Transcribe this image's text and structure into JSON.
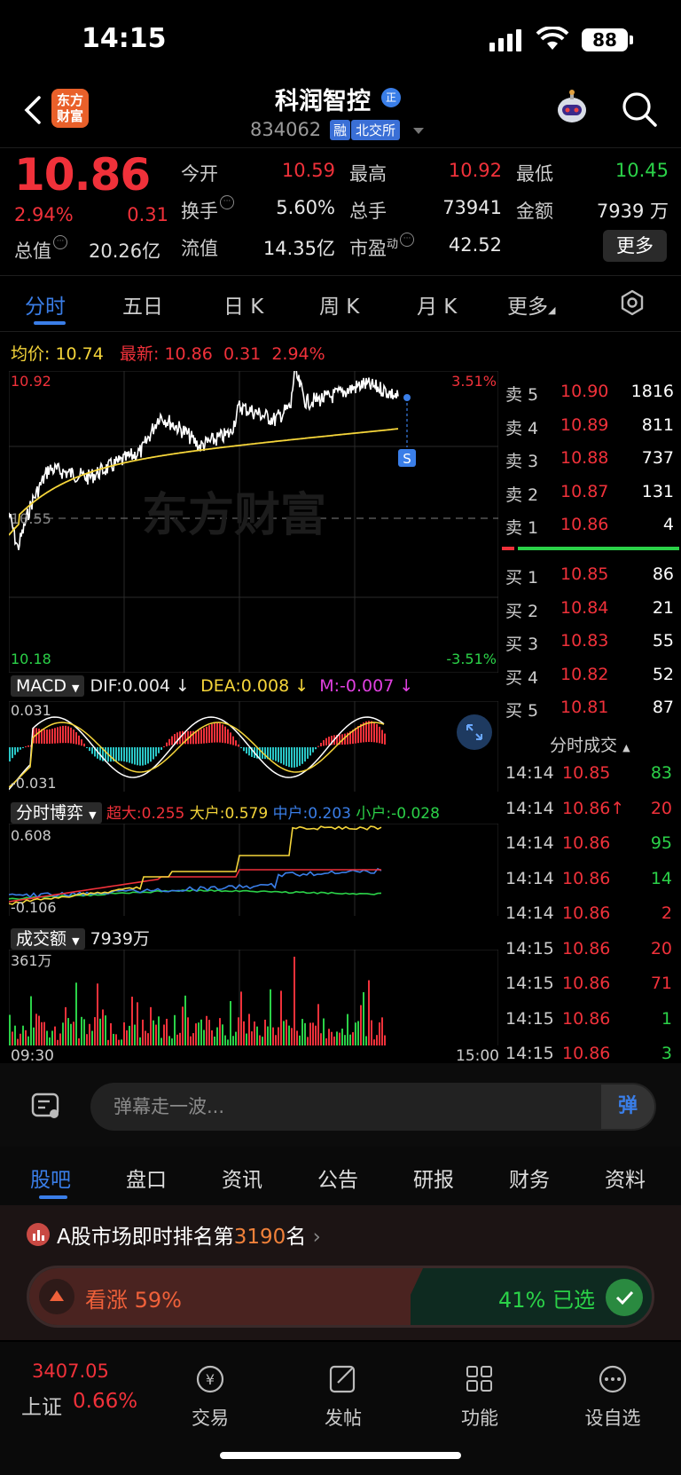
{
  "status": {
    "time": "14:15",
    "battery": "88"
  },
  "header": {
    "logo": "东方财富",
    "stock_name": "科润智控",
    "badge": "正",
    "code": "834062",
    "tag_margin": "融",
    "tag_exchange": "北交所"
  },
  "quote": {
    "price": "10.86",
    "change_pct": "2.94%",
    "change_amt": "0.31",
    "mktcap_label": "总值",
    "mktcap_value": "20.26亿",
    "open_label": "今开",
    "open_value": "10.59",
    "high_label": "最高",
    "high_value": "10.92",
    "low_label": "最低",
    "low_value": "10.45",
    "turnover_label": "换手",
    "turnover_value": "5.60%",
    "vol_label": "总手",
    "vol_value": "73941",
    "amount_label": "金额",
    "amount_value": "7939 万",
    "float_label": "流值",
    "float_value": "14.35亿",
    "pe_label": "市盈",
    "pe_sup": "动",
    "pe_value": "42.52",
    "more": "更多"
  },
  "tabs": [
    "分时",
    "五日",
    "日 K",
    "周 K",
    "月 K",
    "更多"
  ],
  "summary": {
    "avg_label": "均价:",
    "avg_value": "10.74",
    "latest_label": "最新:",
    "latest_value": "10.86",
    "latest_chg": "0.31",
    "latest_pct": "2.94%"
  },
  "main_chart": {
    "ymax_label": "10.92",
    "ymin_label": "10.18",
    "mid_label": "10.55",
    "pct_top": "3.51%",
    "pct_bottom": "-3.51%",
    "watermark": "东方财富",
    "s_marker": "S",
    "time_start": "09:30",
    "time_end": "15:00"
  },
  "macd": {
    "selector": "MACD",
    "dif": "DIF:0.004 ↓",
    "dea": "DEA:0.008 ↓",
    "m": "M:-0.007 ↓",
    "top_label": "0.031",
    "bottom_label": "-0.031"
  },
  "game": {
    "selector": "分时博弈",
    "super": "超大:0.255",
    "large": "大户:0.579",
    "mid": "中户:0.203",
    "small": "小户:-0.028",
    "top_label": "0.608",
    "bottom_label": "-0.106"
  },
  "volume": {
    "selector": "成交额",
    "total": "7939万",
    "top_label": "361万"
  },
  "order_book": {
    "asks": [
      {
        "label": "卖 5",
        "price": "10.90",
        "vol": "1816"
      },
      {
        "label": "卖 4",
        "price": "10.89",
        "vol": "811"
      },
      {
        "label": "卖 3",
        "price": "10.88",
        "vol": "737"
      },
      {
        "label": "卖 2",
        "price": "10.87",
        "vol": "131"
      },
      {
        "label": "卖 1",
        "price": "10.86",
        "vol": "4"
      }
    ],
    "bids": [
      {
        "label": "买 1",
        "price": "10.85",
        "vol": "86"
      },
      {
        "label": "买 2",
        "price": "10.84",
        "vol": "21"
      },
      {
        "label": "买 3",
        "price": "10.83",
        "vol": "55"
      },
      {
        "label": "买 4",
        "price": "10.82",
        "vol": "52"
      },
      {
        "label": "买 5",
        "price": "10.81",
        "vol": "87"
      }
    ]
  },
  "ticks_title": "分时成交",
  "ticks": [
    {
      "time": "14:14",
      "price": "10.85",
      "vol": "83",
      "dir": "green"
    },
    {
      "time": "14:14",
      "price": "10.86↑",
      "vol": "20",
      "dir": "red"
    },
    {
      "time": "14:14",
      "price": "10.86",
      "vol": "95",
      "dir": "green"
    },
    {
      "time": "14:14",
      "price": "10.86",
      "vol": "14",
      "dir": "green"
    },
    {
      "time": "14:14",
      "price": "10.86",
      "vol": "2",
      "dir": "red"
    },
    {
      "time": "14:15",
      "price": "10.86",
      "vol": "20",
      "dir": "red"
    },
    {
      "time": "14:15",
      "price": "10.86",
      "vol": "71",
      "dir": "red"
    },
    {
      "time": "14:15",
      "price": "10.86",
      "vol": "1",
      "dir": "green"
    },
    {
      "time": "14:15",
      "price": "10.86",
      "vol": "3",
      "dir": "green"
    }
  ],
  "chat": {
    "placeholder": "弹幕走一波...",
    "button": "弹"
  },
  "lower_tabs": [
    "股吧",
    "盘口",
    "资讯",
    "公告",
    "研报",
    "财务",
    "资料"
  ],
  "rank": {
    "prefix": "A股市场即时排名第",
    "number": "3190",
    "suffix": "名"
  },
  "vote": {
    "up": "看涨 59%",
    "down": "41%  已选",
    "up_pct": 59
  },
  "bottom_nav": {
    "index_value": "3407.05",
    "index_name": "上证",
    "index_pct": "0.66%",
    "items": [
      "交易",
      "发帖",
      "功能",
      "设自选"
    ]
  },
  "colors": {
    "up": "#f0313a",
    "down": "#2bd148",
    "accent": "#3a7ee8",
    "avg": "#f5d53a"
  }
}
